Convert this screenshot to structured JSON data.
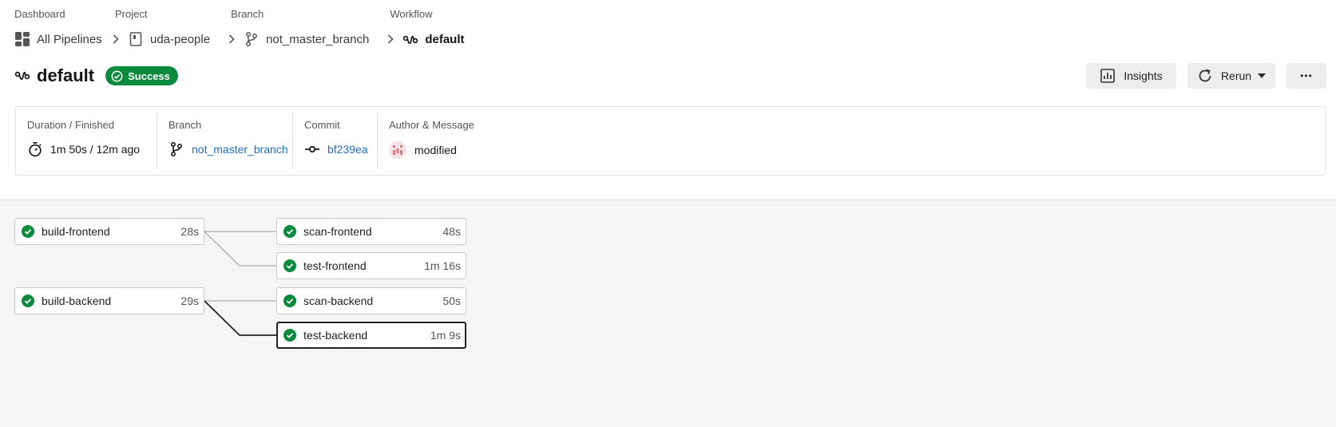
{
  "breadcrumb": [
    {
      "heading": "Dashboard",
      "value": "All Pipelines"
    },
    {
      "heading": "Project",
      "value": "uda-people"
    },
    {
      "heading": "Branch",
      "value": "not_master_branch"
    },
    {
      "heading": "Workflow",
      "value": "default"
    }
  ],
  "workflow": {
    "title": "default",
    "status": "Success"
  },
  "actions": {
    "insights_label": "Insights",
    "rerun_label": "Rerun",
    "more_label": "•••"
  },
  "info": {
    "duration": {
      "label": "Duration / Finished",
      "value": "1m 50s / 12m ago"
    },
    "branch": {
      "label": "Branch",
      "value": "not_master_branch"
    },
    "commit": {
      "label": "Commit",
      "value": "bf239ea"
    },
    "author": {
      "label": "Author & Message",
      "value": "modified"
    }
  },
  "jobs": [
    {
      "name": "build-frontend",
      "duration": "28s"
    },
    {
      "name": "scan-frontend",
      "duration": "48s"
    },
    {
      "name": "test-frontend",
      "duration": "1m 16s"
    },
    {
      "name": "build-backend",
      "duration": "29s"
    },
    {
      "name": "scan-backend",
      "duration": "50s"
    },
    {
      "name": "test-backend",
      "duration": "1m 9s"
    }
  ],
  "colors": {
    "success": "#0a8a3c",
    "link": "#1b6fc2",
    "graph_bg": "#f5f5f5"
  }
}
